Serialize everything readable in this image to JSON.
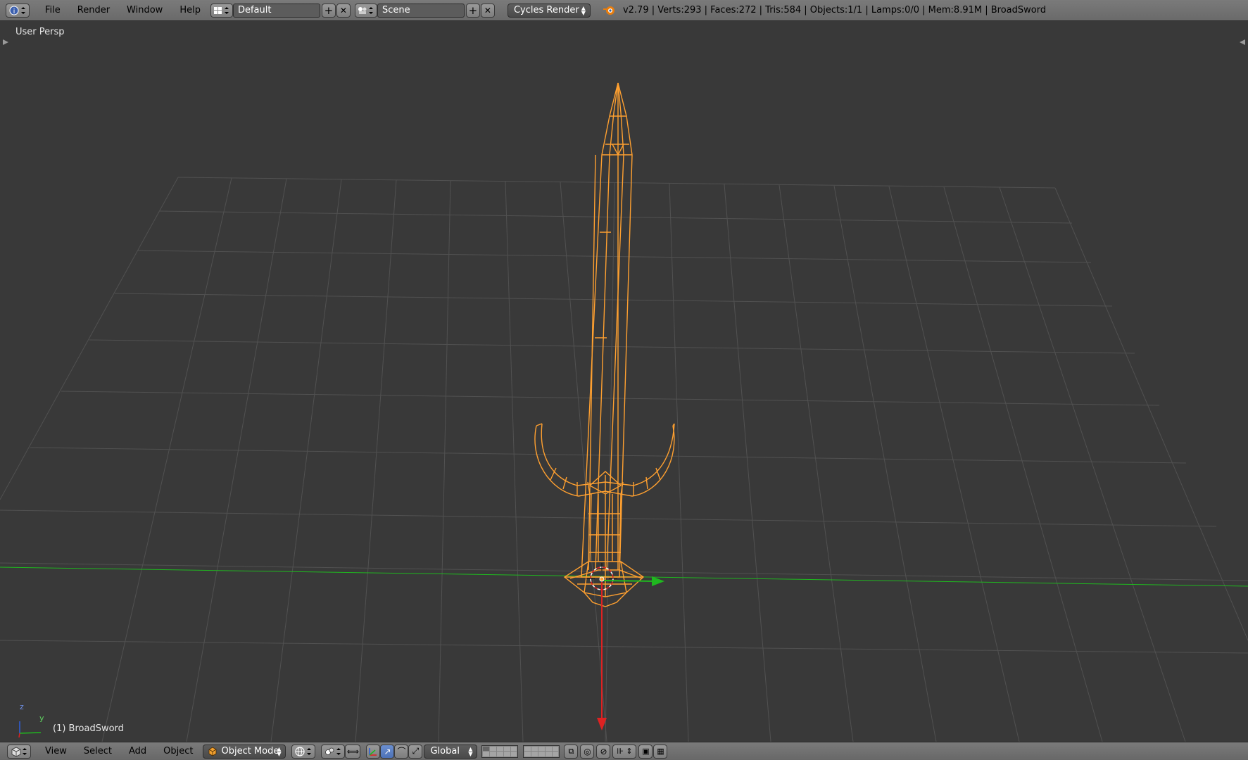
{
  "top_bar": {
    "menus": [
      "File",
      "Render",
      "Window",
      "Help"
    ],
    "screen_layout": "Default",
    "scene": "Scene",
    "render_engine": "Cycles Render",
    "info_text": "v2.79 | Verts:293 | Faces:272 | Tris:584 | Objects:1/1 | Lamps:0/0 | Mem:8.91M | BroadSword"
  },
  "viewport": {
    "view_name": "User Persp",
    "object_label": "(1) BroadSword",
    "axis_z": "z",
    "axis_y": "y"
  },
  "bottom_bar": {
    "menus": [
      "View",
      "Select",
      "Add",
      "Object"
    ],
    "mode": "Object Mode",
    "orientation": "Global"
  },
  "colors": {
    "wire": "#ffa030",
    "grid": "#515151",
    "x_axis": "#d22",
    "y_axis": "#1fb81f"
  },
  "icons": {
    "info": "info-icon",
    "render": "blender-logo-icon",
    "editor": "3d-view-icon"
  }
}
